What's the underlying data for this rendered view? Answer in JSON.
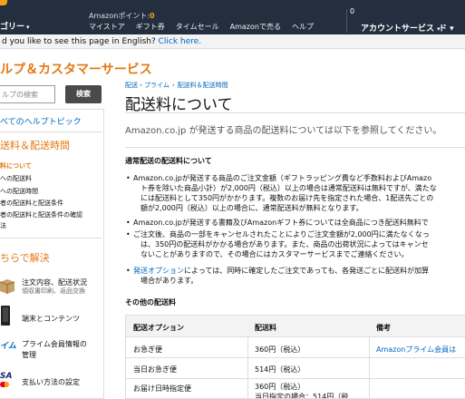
{
  "header": {
    "categories_label": "ゴリー",
    "points_label": "Amazonポイント:",
    "points_value": "0",
    "nav_links": [
      "マイストア",
      "ギフト券",
      "タイムセール",
      "Amazonで売る",
      "ヘルプ"
    ],
    "cart_count": "0",
    "account_label": "アカウントサービス",
    "last_menu_label": "ド"
  },
  "english_bar": {
    "text": "d you like to see this page in English?",
    "link": "Click here."
  },
  "sidebar": {
    "title": "ルプ＆カスタマーサービス",
    "search_placeholder": "ルプの検索",
    "search_button": "検索",
    "all_help_link": "べてのヘルプトピック",
    "section_heading": "送料＆配送時間",
    "section_items": [
      {
        "label": "料について",
        "active": true
      },
      {
        "label": "への配送料",
        "active": false
      },
      {
        "label": "への配送時間",
        "active": false
      },
      {
        "label": "者の配送料と配送条件",
        "active": false
      },
      {
        "label": "者の配送料と配送条件の確認",
        "active": false
      },
      {
        "label": "法",
        "active": false
      }
    ],
    "solve_heading": "ちらで解決",
    "solve_items": [
      {
        "icon": "package-icon",
        "label": "注文内容、配送状況",
        "sub": "領収書印刷、返品交換"
      },
      {
        "icon": "device-icon",
        "label": "端末とコンテンツ",
        "sub": ""
      },
      {
        "icon": "prime-icon",
        "icon_text": "イム",
        "label": "プライム会員情報の",
        "sub": "管理"
      },
      {
        "icon": "card-icon",
        "icon_text": "SA",
        "label": "支払い方法の設定",
        "sub": ""
      }
    ]
  },
  "main": {
    "breadcrumb": [
      "配送・プライム",
      "配送料＆配送時間"
    ],
    "title": "配送料について",
    "intro": "Amazon.co.jp が発送する商品の配送料については以下を参照してください。",
    "section1_title": "通常配送の配送料について",
    "bullets": [
      {
        "lines": [
          "Amazon.co.jpが発送する商品のご注文金額（ギフトラッピング費など手数料およびAmazo",
          "ト券を除いた商品小計）が2,000円（税込）以上の場合は通常配送料は無料ですが、満たな",
          "には配送料として350円がかかります。複数のお届け先を指定された場合、1配送先ごとの",
          "額が2,000円（税込）以上の場合に、通常配送料が無料となります。"
        ]
      },
      {
        "lines": [
          "Amazon.co.jpが発送する書籍及びAmazonギフト券については全商品につき配送料無料で"
        ]
      },
      {
        "lines": [
          "ご注文後、商品の一部をキャンセルされたことによりご注文金額が2,000円に満たなくなっ",
          "は、350円の配送料がかかる場合があります。また、商品の出荷状況によってはキャンセ",
          "ないことがありますので、その場合にはカスタマーサービスまでご連絡ください。"
        ]
      },
      {
        "link": "発送オプション",
        "lines": [
          "によっては、同時に確定したご注文であっても、各発送ごとに配送料が加算",
          "場合があります。"
        ]
      }
    ],
    "section2_title": "その他の配送料",
    "table": {
      "headers": [
        "配送オプション",
        "配送料",
        "備考"
      ],
      "rows": [
        {
          "option": "お急ぎ便",
          "fee": "360円（税込）",
          "note": "Amazonプライム会員は"
        },
        {
          "option": "当日お急ぎ便",
          "fee": "514円（税込）",
          "note": ""
        },
        {
          "option": "お届け日時指定便",
          "fee": "360円（税込）",
          "fee_extra": "当日指定の場合：514円（税",
          "note": ""
        }
      ]
    }
  },
  "colors": {
    "header_bg": "#232f3e",
    "accent_orange": "#e47911",
    "link_blue": "#0066c0"
  }
}
